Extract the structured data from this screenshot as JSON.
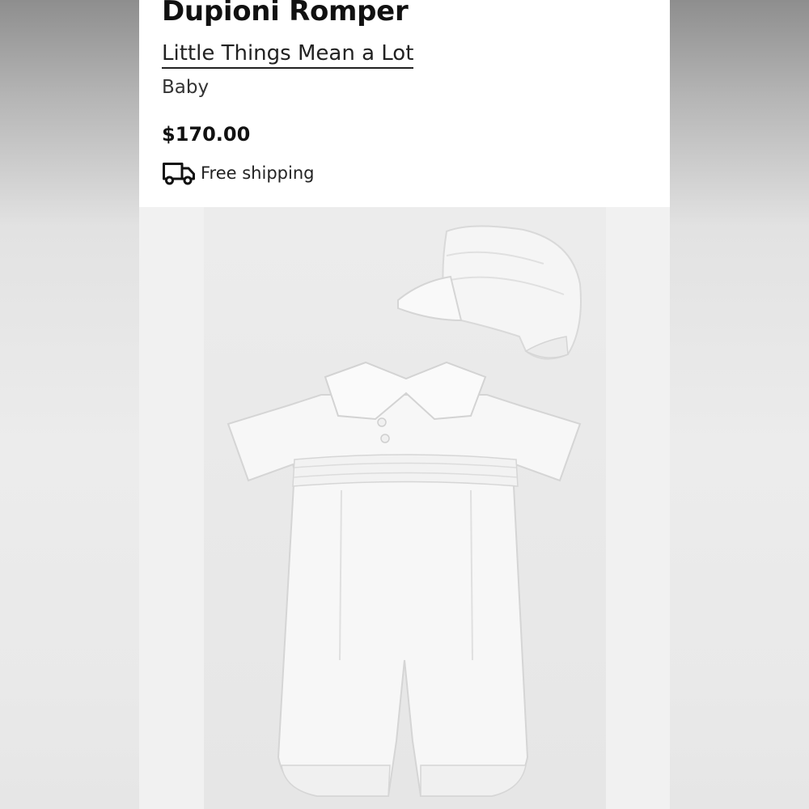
{
  "product": {
    "title": "Dupioni Romper",
    "brand": "Little Things Mean a Lot",
    "category": "Baby",
    "price": "$170.00",
    "shipping_label": "Free shipping"
  },
  "icons": {
    "shipping": "truck-icon"
  },
  "colors": {
    "text": "#111111",
    "card_background": "#ffffff",
    "photo_background": "#e9e9e9",
    "garment": "#f7f7f7"
  }
}
